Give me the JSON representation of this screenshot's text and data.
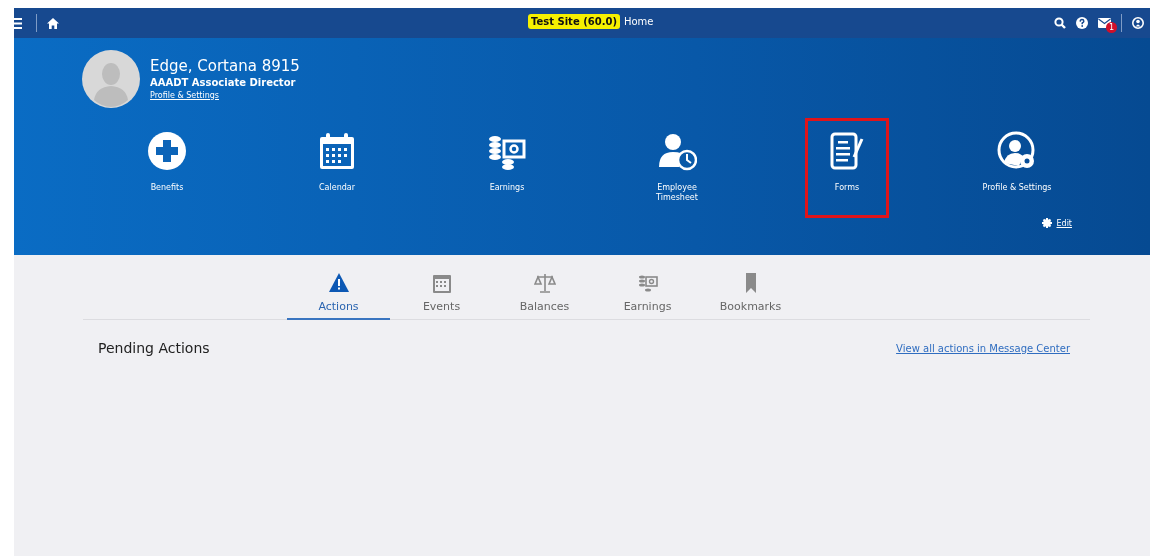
{
  "top_bar": {
    "site_badge": "Test Site (60.0)",
    "page_title": "Home",
    "mail_badge": "1"
  },
  "profile": {
    "name": "Edge, Cortana 8915",
    "title": "AAADT Associate Director",
    "link": "Profile & Settings"
  },
  "tiles": [
    {
      "label": "Benefits",
      "kind": "plus",
      "highlighted": false
    },
    {
      "label": "Calendar",
      "kind": "calendar",
      "highlighted": false
    },
    {
      "label": "Earnings",
      "kind": "money",
      "highlighted": false
    },
    {
      "label": "Employee Timesheet",
      "kind": "timesheet",
      "highlighted": false
    },
    {
      "label": "Forms",
      "kind": "form",
      "highlighted": true
    },
    {
      "label": "Profile & Settings",
      "kind": "profile",
      "highlighted": false
    }
  ],
  "edit_link": "Edit",
  "tabs": [
    {
      "label": "Actions",
      "kind": "warning",
      "selected": true
    },
    {
      "label": "Events",
      "kind": "calendar",
      "selected": false
    },
    {
      "label": "Balances",
      "kind": "scale",
      "selected": false
    },
    {
      "label": "Earnings",
      "kind": "money",
      "selected": false
    },
    {
      "label": "Bookmarks",
      "kind": "bookmark",
      "selected": false
    }
  ],
  "section": {
    "heading": "Pending Actions",
    "link": "View all actions in Message Center"
  }
}
